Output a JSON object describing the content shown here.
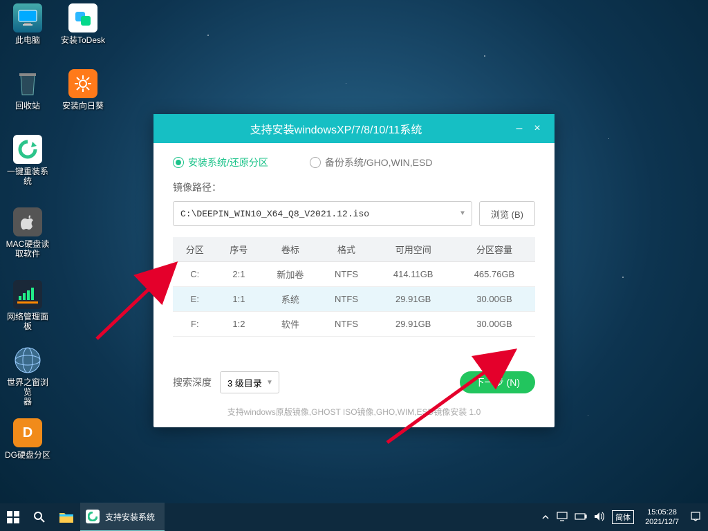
{
  "desktop_icons": [
    {
      "label": "此电脑"
    },
    {
      "label": "安装ToDesk"
    },
    {
      "label": "回收站"
    },
    {
      "label": "安装向日葵"
    },
    {
      "label": "一键重装系统"
    },
    {
      "label": "MAC硬盘读\n取软件"
    },
    {
      "label": "网络管理面板"
    },
    {
      "label": "世界之窗浏览\n器"
    },
    {
      "label": "DG硬盘分区"
    }
  ],
  "window": {
    "title": "支持安装windowsXP/7/8/10/11系统",
    "minimize": "–",
    "close": "×",
    "tab_install": "安装系统/还原分区",
    "tab_backup": "备份系统/GHO,WIN,ESD",
    "path_label": "镜像路径：",
    "path_value": "C:\\DEEPIN_WIN10_X64_Q8_V2021.12.iso",
    "browse": "浏览 (B)",
    "headers": {
      "part": "分区",
      "num": "序号",
      "vol": "卷标",
      "fmt": "格式",
      "free": "可用空间",
      "size": "分区容量"
    },
    "rows": [
      {
        "part": "C:",
        "num": "2:1",
        "vol": "新加卷",
        "fmt": "NTFS",
        "free": "414.11GB",
        "size": "465.76GB"
      },
      {
        "part": "E:",
        "num": "1:1",
        "vol": "系统",
        "fmt": "NTFS",
        "free": "29.91GB",
        "size": "30.00GB"
      },
      {
        "part": "F:",
        "num": "1:2",
        "vol": "软件",
        "fmt": "NTFS",
        "free": "29.91GB",
        "size": "30.00GB"
      }
    ],
    "depth_label": "搜索深度",
    "depth_value": "3 级目录",
    "next": "下一步 (N)",
    "hint": "支持windows原版镜像,GHOST ISO镜像,GHO,WIM,ESD镜像安装       1.0"
  },
  "taskbar": {
    "running": "支持安装系统",
    "ime": "简体",
    "time": "15:05:28",
    "date": "2021/12/7"
  }
}
